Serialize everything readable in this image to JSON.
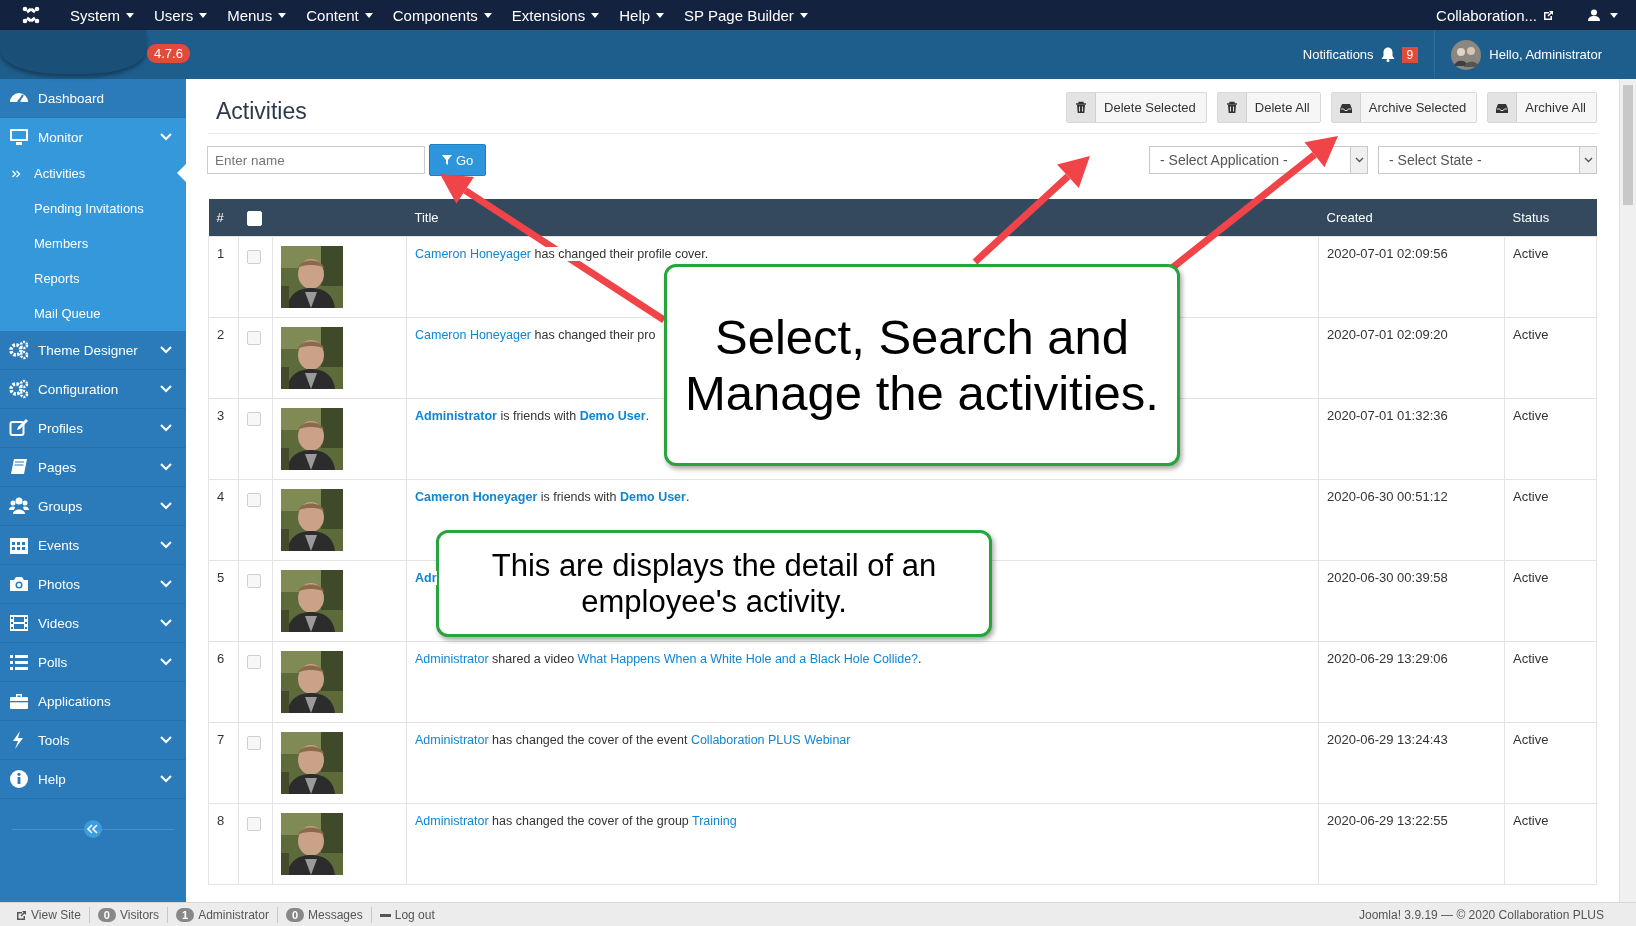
{
  "top_menu": {
    "items": [
      {
        "label": "System"
      },
      {
        "label": "Users"
      },
      {
        "label": "Menus"
      },
      {
        "label": "Content"
      },
      {
        "label": "Components"
      },
      {
        "label": "Extensions"
      },
      {
        "label": "Help"
      },
      {
        "label": "SP Page Builder"
      }
    ],
    "site_link": "Collaboration..."
  },
  "header": {
    "version": "4.7.6",
    "notifications_label": "Notifications",
    "notifications_count": "9",
    "greeting": "Hello, Administrator"
  },
  "sidebar": {
    "items": [
      {
        "label": "Dashboard",
        "has_children": false,
        "expanded": false
      },
      {
        "label": "Monitor",
        "has_children": true,
        "expanded": true,
        "children": [
          {
            "label": "Activities",
            "selected": true
          },
          {
            "label": "Pending Invitations",
            "selected": false
          },
          {
            "label": "Members",
            "selected": false
          },
          {
            "label": "Reports",
            "selected": false
          },
          {
            "label": "Mail Queue",
            "selected": false
          }
        ]
      },
      {
        "label": "Theme Designer",
        "has_children": true,
        "expanded": false
      },
      {
        "label": "Configuration",
        "has_children": true,
        "expanded": false
      },
      {
        "label": "Profiles",
        "has_children": true,
        "expanded": false
      },
      {
        "label": "Pages",
        "has_children": true,
        "expanded": false
      },
      {
        "label": "Groups",
        "has_children": true,
        "expanded": false
      },
      {
        "label": "Events",
        "has_children": true,
        "expanded": false
      },
      {
        "label": "Photos",
        "has_children": true,
        "expanded": false
      },
      {
        "label": "Videos",
        "has_children": true,
        "expanded": false
      },
      {
        "label": "Polls",
        "has_children": true,
        "expanded": false
      },
      {
        "label": "Applications",
        "has_children": false,
        "expanded": false
      },
      {
        "label": "Tools",
        "has_children": true,
        "expanded": false
      },
      {
        "label": "Help",
        "has_children": true,
        "expanded": false
      }
    ]
  },
  "page": {
    "title": "Activities",
    "toolbar": [
      {
        "label": "Delete Selected",
        "kind": "delete"
      },
      {
        "label": "Delete All",
        "kind": "delete"
      },
      {
        "label": "Archive Selected",
        "kind": "archive"
      },
      {
        "label": "Archive All",
        "kind": "archive"
      }
    ]
  },
  "filters": {
    "search": {
      "placeholder": "Enter name"
    },
    "go_button": "Go",
    "selects": [
      "- Select Application -",
      "- Select State -"
    ]
  },
  "table": {
    "columns": [
      "#",
      "Title",
      "Created",
      "Status"
    ],
    "select_all_checked": false,
    "rows": [
      {
        "number": "1",
        "checked": false,
        "title": [
          {
            "text": "Cameron Honeyager",
            "link": true,
            "bold": false
          },
          {
            "text": " has changed their profile cover.",
            "link": false,
            "bold": false
          }
        ],
        "created": "2020-07-01 02:09:56",
        "status": "Active"
      },
      {
        "number": "2",
        "checked": false,
        "title": [
          {
            "text": "Cameron Honeyager",
            "link": true,
            "bold": false
          },
          {
            "text": " has changed their pro",
            "link": false,
            "bold": false
          }
        ],
        "created": "2020-07-01 02:09:20",
        "status": "Active"
      },
      {
        "number": "3",
        "checked": false,
        "title": [
          {
            "text": "Administrator",
            "link": true,
            "bold": true
          },
          {
            "text": " is friends with ",
            "link": false,
            "bold": false
          },
          {
            "text": "Demo User",
            "link": true,
            "bold": true
          },
          {
            "text": ".",
            "link": false,
            "bold": false
          }
        ],
        "created": "2020-07-01 01:32:36",
        "status": "Active"
      },
      {
        "number": "4",
        "checked": false,
        "title": [
          {
            "text": "Cameron Honeyager",
            "link": true,
            "bold": true
          },
          {
            "text": " is friends with ",
            "link": false,
            "bold": false
          },
          {
            "text": "Demo User",
            "link": true,
            "bold": true
          },
          {
            "text": ".",
            "link": false,
            "bold": false
          }
        ],
        "created": "2020-06-30 00:51:12",
        "status": "Active"
      },
      {
        "number": "5",
        "checked": false,
        "title": [
          {
            "text": "Adr",
            "link": true,
            "bold": true
          }
        ],
        "created": "2020-06-30 00:39:58",
        "status": "Active"
      },
      {
        "number": "6",
        "checked": false,
        "title": [
          {
            "text": "Administrator",
            "link": true,
            "bold": false
          },
          {
            "text": " shared a video ",
            "link": false,
            "bold": false
          },
          {
            "text": "What Happens When a White Hole and a Black Hole Collide?",
            "link": true,
            "bold": false
          },
          {
            "text": ".",
            "link": false,
            "bold": false
          }
        ],
        "created": "2020-06-29 13:29:06",
        "status": "Active"
      },
      {
        "number": "7",
        "checked": false,
        "title": [
          {
            "text": "Administrator",
            "link": true,
            "bold": false
          },
          {
            "text": " has changed the cover of the event ",
            "link": false,
            "bold": false
          },
          {
            "text": "Collaboration PLUS Webinar",
            "link": true,
            "bold": false
          }
        ],
        "created": "2020-06-29 13:24:43",
        "status": "Active"
      },
      {
        "number": "8",
        "checked": false,
        "title": [
          {
            "text": "Administrator",
            "link": true,
            "bold": false
          },
          {
            "text": " has changed the cover of the group ",
            "link": false,
            "bold": false
          },
          {
            "text": "Training",
            "link": true,
            "bold": false
          }
        ],
        "created": "2020-06-29 13:22:55",
        "status": "Active"
      }
    ]
  },
  "callouts": [
    {
      "text": "Select, Search and Manage the activities."
    },
    {
      "text": "This are displays the detail of an employee's activity."
    }
  ],
  "status_bar": {
    "items": [
      {
        "kind": "site",
        "label": "View Site"
      },
      {
        "kind": "count",
        "count": "0",
        "label": "Visitors"
      },
      {
        "kind": "count",
        "count": "1",
        "label": "Administrator"
      },
      {
        "kind": "count",
        "count": "0",
        "label": "Messages"
      },
      {
        "kind": "logout",
        "label": "Log out"
      }
    ],
    "credits": "Joomla! 3.9.19 — © 2020 Collaboration PLUS"
  }
}
